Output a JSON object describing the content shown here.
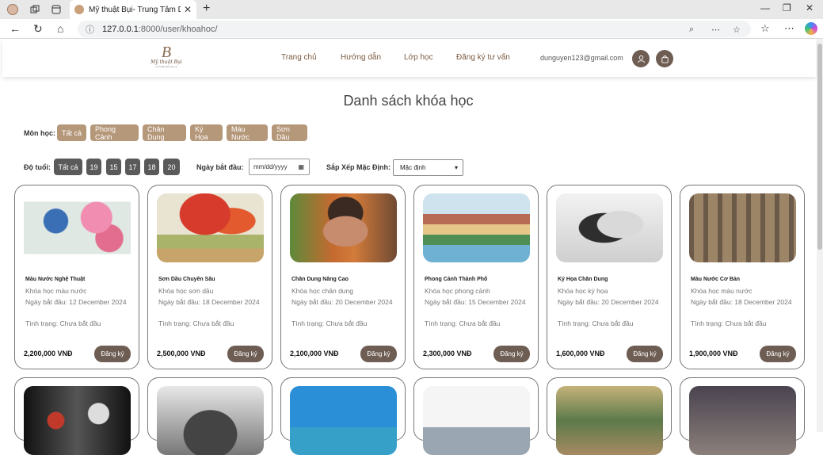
{
  "browser": {
    "tab_title": "Mỹ thuật Bụi- Trung Tâm Dạy Vẽ",
    "url_host": "127.0.0.1",
    "url_rest": ":8000/user/khoahoc/"
  },
  "site": {
    "logo_letter": "B",
    "logo_text": "Mỹ thuật Bụi",
    "logo_sub": "mỹ thuật đẹp dạy vẽ",
    "nav": [
      "Trang chủ",
      "Hướng dẫn",
      "Lớp học",
      "Đăng ký tư vấn"
    ],
    "user_email": "dunguyen123@gmail.com"
  },
  "page": {
    "title": "Danh sách khóa học",
    "subject_label": "Môn học:",
    "subjects": [
      "Tất cả",
      "Phong Cảnh",
      "Chân Dung",
      "Ký Họa",
      "Màu Nước",
      "Sơn Dầu"
    ],
    "age_label": "Độ tuổi:",
    "ages": [
      "Tất cả",
      "19",
      "15",
      "17",
      "18",
      "20"
    ],
    "start_label": "Ngày bắt đầu:",
    "date_placeholder": "mm/dd/yyyy",
    "sort_label": "Sắp Xếp Mặc Định:",
    "sort_value": "Mặc định",
    "register_label": "Đăng ký"
  },
  "courses": [
    {
      "title": "Màu Nước Nghệ Thuật",
      "category": "Khóa học màu nước",
      "start": "Ngày bắt đầu: 12 December 2024",
      "status": "Tình trạng: Chưa bắt đầu",
      "price": "2,200,000 VNĐ"
    },
    {
      "title": "Sơn Dầu Chuyên Sâu",
      "category": "Khóa học sơn dầu",
      "start": "Ngày bắt đầu: 18 December 2024",
      "status": "Tình trạng: Chưa bắt đầu",
      "price": "2,500,000 VNĐ"
    },
    {
      "title": "Chân Dung Nâng Cao",
      "category": "Khóa học chân dung",
      "start": "Ngày bắt đầu: 20 December 2024",
      "status": "Tình trạng: Chưa bắt đầu",
      "price": "2,100,000 VNĐ"
    },
    {
      "title": "Phong Cảnh Thành Phố",
      "category": "Khóa học phong cảnh",
      "start": "Ngày bắt đầu: 15 December 2024",
      "status": "Tình trạng: Chưa bắt đầu",
      "price": "2,300,000 VNĐ"
    },
    {
      "title": "Ký Họa Chân Dung",
      "category": "Khóa học ký họa",
      "start": "Ngày bắt đầu: 20 December 2024",
      "status": "Tình trạng: Chưa bắt đầu",
      "price": "1,600,000 VNĐ"
    },
    {
      "title": "Màu Nước Cơ Bản",
      "category": "Khóa học màu nước",
      "start": "Ngày bắt đầu: 18 December 2024",
      "status": "Tình trạng: Chưa bắt đầu",
      "price": "1,900,000 VNĐ"
    }
  ]
}
